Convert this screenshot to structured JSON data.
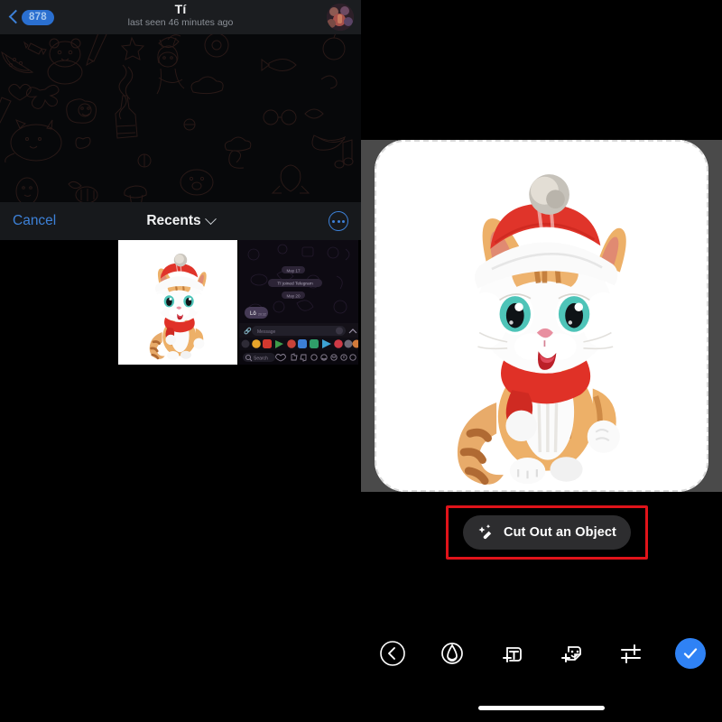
{
  "left_panel": {
    "chat_header": {
      "back_icon": "chevron-left-icon",
      "unread_badge": "878",
      "title": "Tí",
      "subtitle": "last seen 46 minutes ago",
      "avatar_icon": "contact-avatar"
    },
    "picker": {
      "cancel_label": "Cancel",
      "album_label": "Recents",
      "chevron_icon": "chevron-down-icon",
      "more_icon": "more-options-icon",
      "thumbnails": [
        {
          "name": "cat-photo-thumbnail",
          "kind": "photo",
          "selected": false
        },
        {
          "name": "telegram-screenshot-thumbnail",
          "kind": "screenshot",
          "selected": false
        }
      ]
    },
    "screenshot_thumb_text": {
      "date_1": "May 17",
      "joined": "Tí joined Telegram",
      "date_2": "May 20",
      "message_bubble": "Lô",
      "message_time": "20:32",
      "composer_placeholder": "Message",
      "search_label": "Search"
    }
  },
  "right_panel": {
    "image_alt": "Cartoon kitten wearing a red Santa hat and red scarf",
    "selection": "marching-ants-selection",
    "cutout": {
      "icon": "magic-wand-icon",
      "label": "Cut Out an Object",
      "highlight_color": "#e0131a"
    },
    "toolbar": [
      {
        "name": "back-button",
        "icon": "chevron-left-circle-icon",
        "label": "Back"
      },
      {
        "name": "draw-tool-button",
        "icon": "brush-pen-icon",
        "label": "Draw"
      },
      {
        "name": "add-text-button",
        "icon": "add-text-icon",
        "label": "Add Text"
      },
      {
        "name": "add-sticker-button",
        "icon": "add-sticker-icon",
        "label": "Add Sticker"
      },
      {
        "name": "adjust-button",
        "icon": "sliders-icon",
        "label": "Adjust"
      },
      {
        "name": "confirm-button",
        "icon": "checkmark-icon",
        "label": "Done"
      }
    ],
    "accent_color": "#2f82f5",
    "home_indicator": "home-indicator"
  }
}
